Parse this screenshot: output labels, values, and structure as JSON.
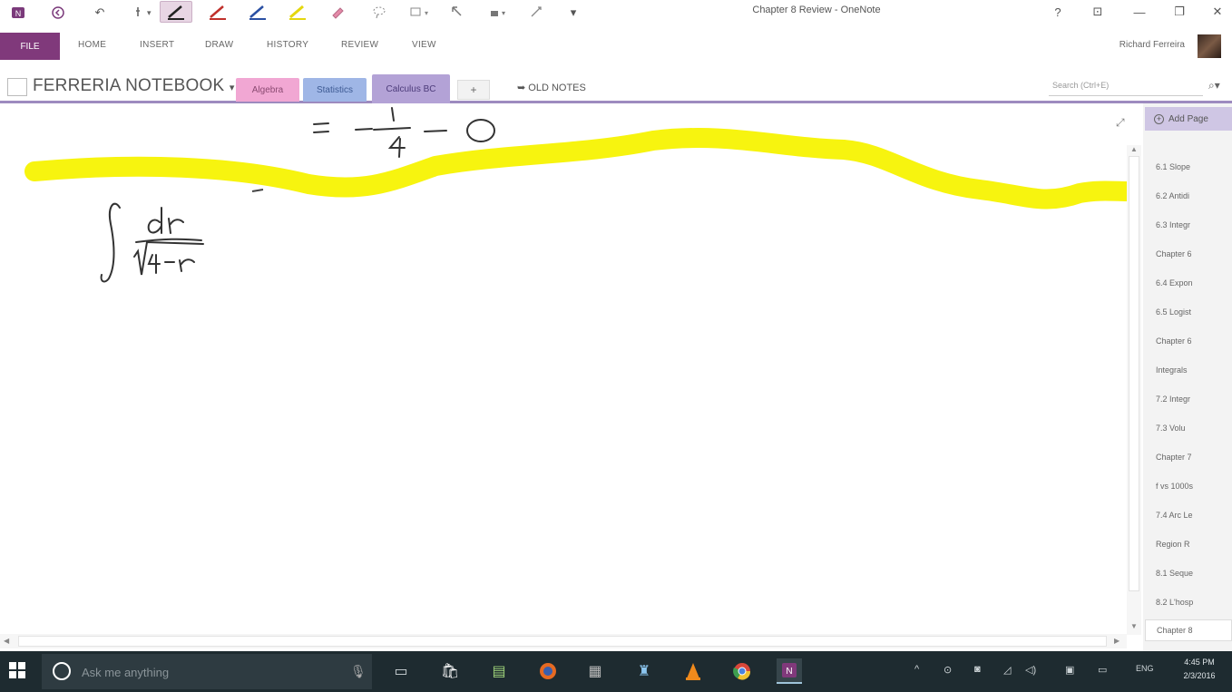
{
  "titlebar": {
    "window_title": "Chapter 8 Review - OneNote",
    "quick_access": [
      "↶",
      "▾"
    ],
    "controls": {
      "help": "?",
      "restore_mode": "⊡",
      "minimize": "—",
      "maximize": "❐",
      "close": "✕"
    }
  },
  "ribbon": {
    "file": "FILE",
    "tabs": [
      "HOME",
      "INSERT",
      "DRAW",
      "HISTORY",
      "REVIEW",
      "VIEW"
    ],
    "user": "Richard Ferreira"
  },
  "notebook": {
    "title": "FERRERIA NOTEBOOK",
    "sections": [
      {
        "label": "Algebra",
        "color": "#f1a7d3"
      },
      {
        "label": "Statistics",
        "color": "#9fb6e6"
      },
      {
        "label": "Calculus BC",
        "color": "#b3a2d6"
      }
    ],
    "add_section": "+",
    "old_notes": "OLD NOTES",
    "search_placeholder": "Search (Ctrl+E)",
    "search_icon": "⌕▾"
  },
  "canvas": {
    "ink_top": "= − 1/4 − 0",
    "highlighter_color": "#f7f40f",
    "integral": "∫ dr / √(4−r)"
  },
  "pages": {
    "add_page": "Add Page",
    "items": [
      "6.1 Slope",
      "6.2 Antidi",
      "6.3 Integr",
      "Chapter 6",
      "6.4 Expon",
      "6.5 Logist",
      "Chapter 6",
      "Integrals",
      "7.2 Integr",
      "7.3 Volu",
      "Chapter 7",
      "f vs 1000s",
      "7.4 Arc Le",
      "Region R",
      "8.1 Seque",
      "8.2 L'hosp",
      "Chapter 8"
    ]
  },
  "taskbar": {
    "cortana_placeholder": "Ask me anything",
    "clock_time": "4:45 PM",
    "clock_date": "2/3/2016",
    "lang": "ENG"
  }
}
